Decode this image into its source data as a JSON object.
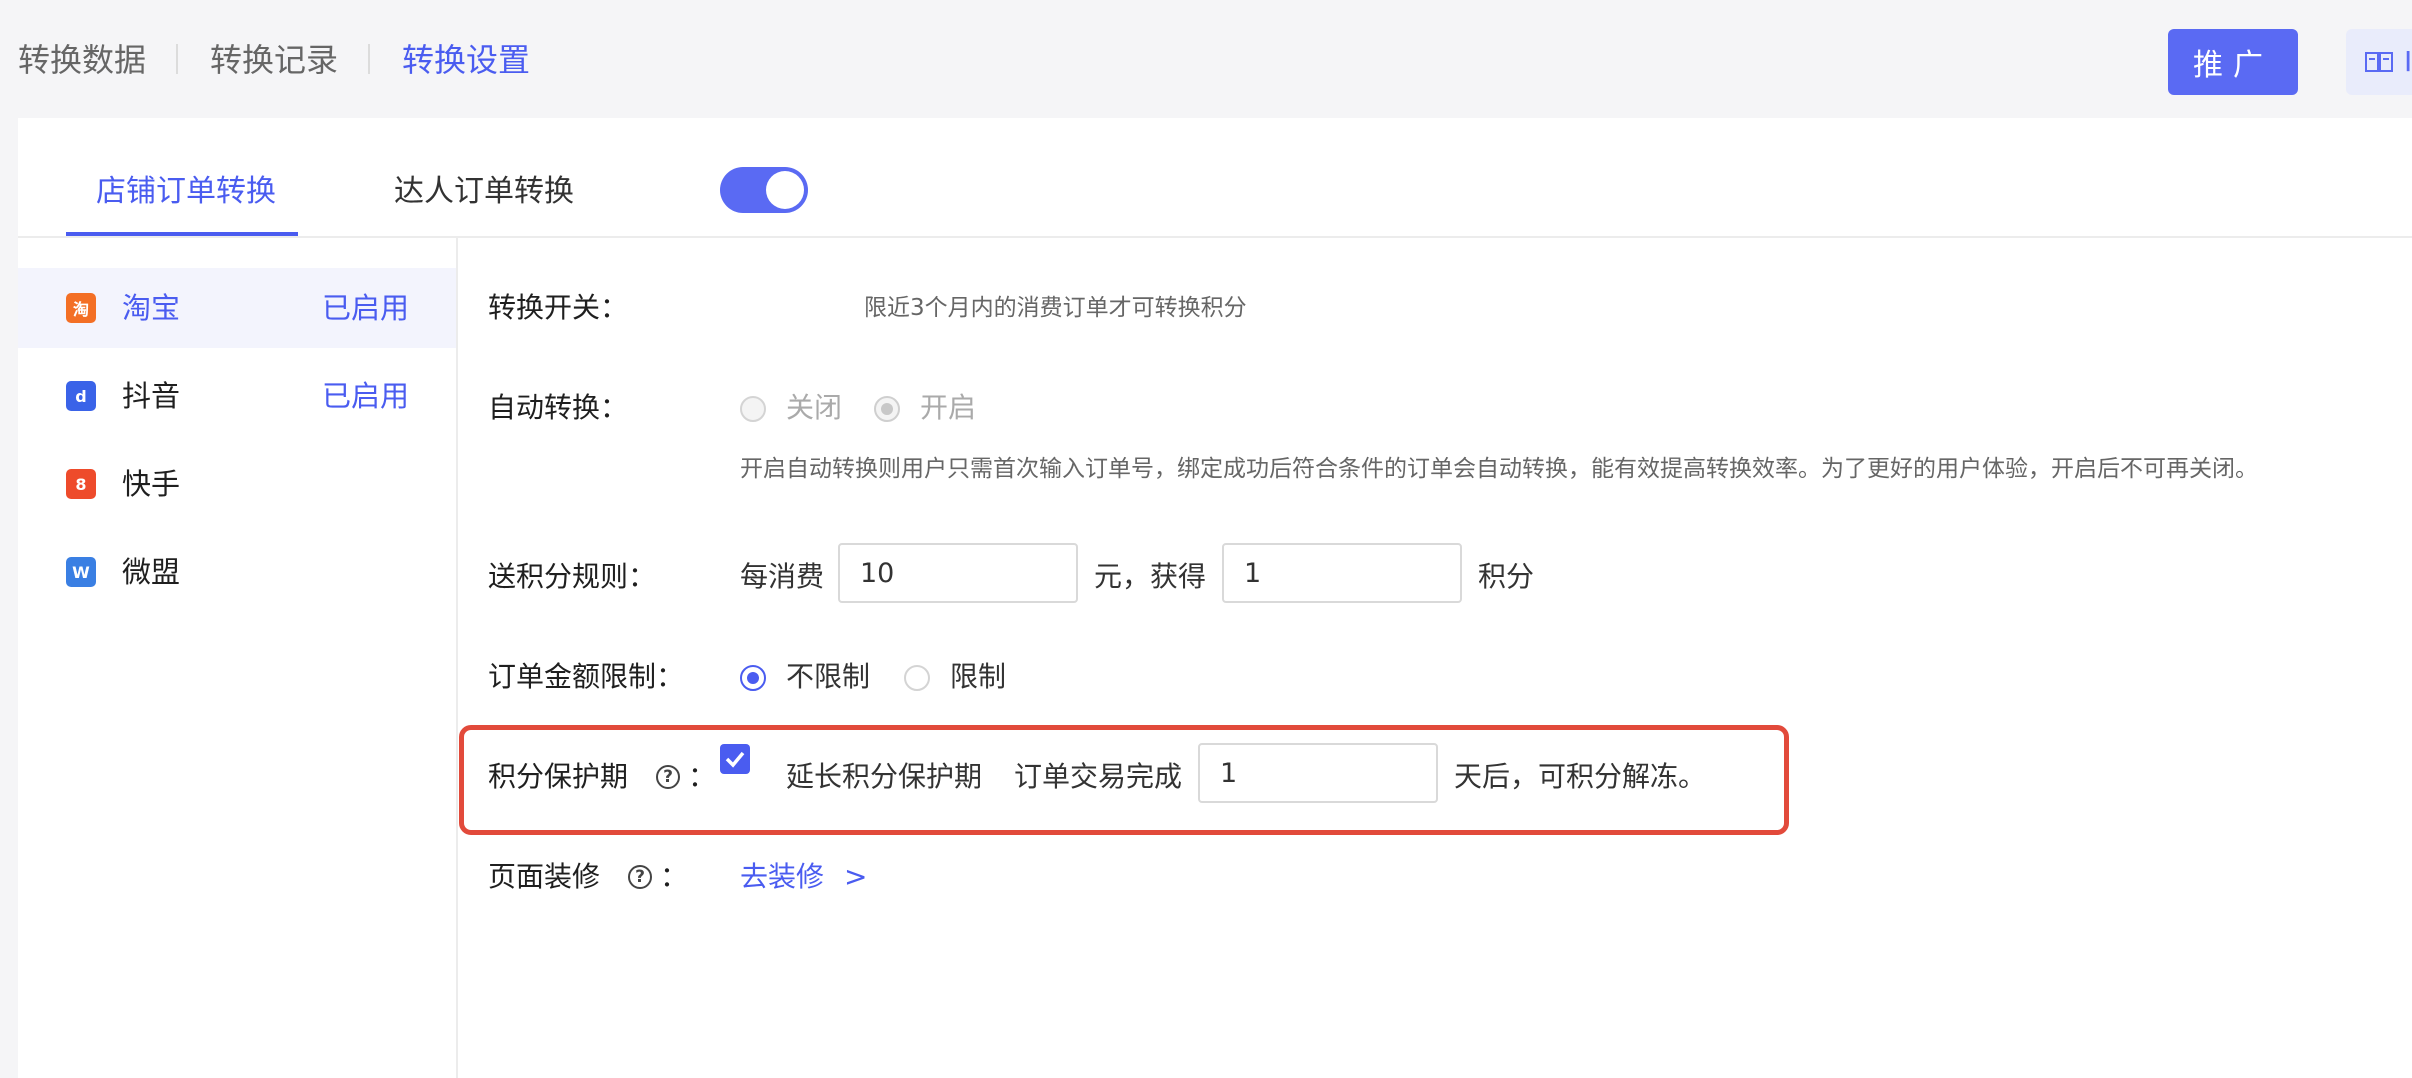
{
  "top_nav": {
    "tabs": [
      {
        "label": "转换数据"
      },
      {
        "label": "转换记录"
      },
      {
        "label": "转换设置"
      }
    ],
    "promo_button": "推广",
    "tool_button_partial": "I"
  },
  "sub_tabs": [
    {
      "label": "店铺订单转换"
    },
    {
      "label": "达人订单转换"
    }
  ],
  "platforms": [
    {
      "icon_char": "淘",
      "name": "淘宝",
      "status": "已启用",
      "icon_color": "#f36f25"
    },
    {
      "icon_char": "d",
      "name": "抖音",
      "status": "已启用",
      "icon_color": "#3a63e8"
    },
    {
      "icon_char": "8",
      "name": "快手",
      "status": "",
      "icon_color": "#ee4b2b"
    },
    {
      "icon_char": "W",
      "name": "微盟",
      "status": "",
      "icon_color": "#3a7fe3"
    }
  ],
  "settings": {
    "switch": {
      "label": "转换开关：",
      "hint": "限近3个月内的消费订单才可转换积分",
      "enabled": true
    },
    "auto": {
      "label": "自动转换：",
      "option_off": "关闭",
      "option_on": "开启",
      "selected": "开启",
      "desc": "开启自动转换则用户只需首次输入订单号，绑定成功后符合条件的订单会自动转换，能有效提高转换效率。为了更好的用户体验，开启后不可再关闭。"
    },
    "rule": {
      "label": "送积分规则：",
      "prefix": "每消费",
      "spend_value": "10",
      "middle": "元，获得",
      "points_value": "1",
      "suffix": "积分"
    },
    "limit": {
      "label": "订单金额限制：",
      "option_nolimit": "不限制",
      "option_limit": "限制",
      "selected": "不限制"
    },
    "protect": {
      "label": "积分保护期",
      "colon": "：",
      "checkbox_label": "延长积分保护期",
      "checked": true,
      "prefix": "订单交易完成",
      "days_value": "1",
      "suffix": "天后，可积分解冻。"
    },
    "decor": {
      "label": "页面装修",
      "colon": "：",
      "link": "去装修",
      "link_arrow": ">"
    }
  },
  "colors": {
    "accent": "#4a5cf0",
    "highlight": "#e24a3b"
  }
}
